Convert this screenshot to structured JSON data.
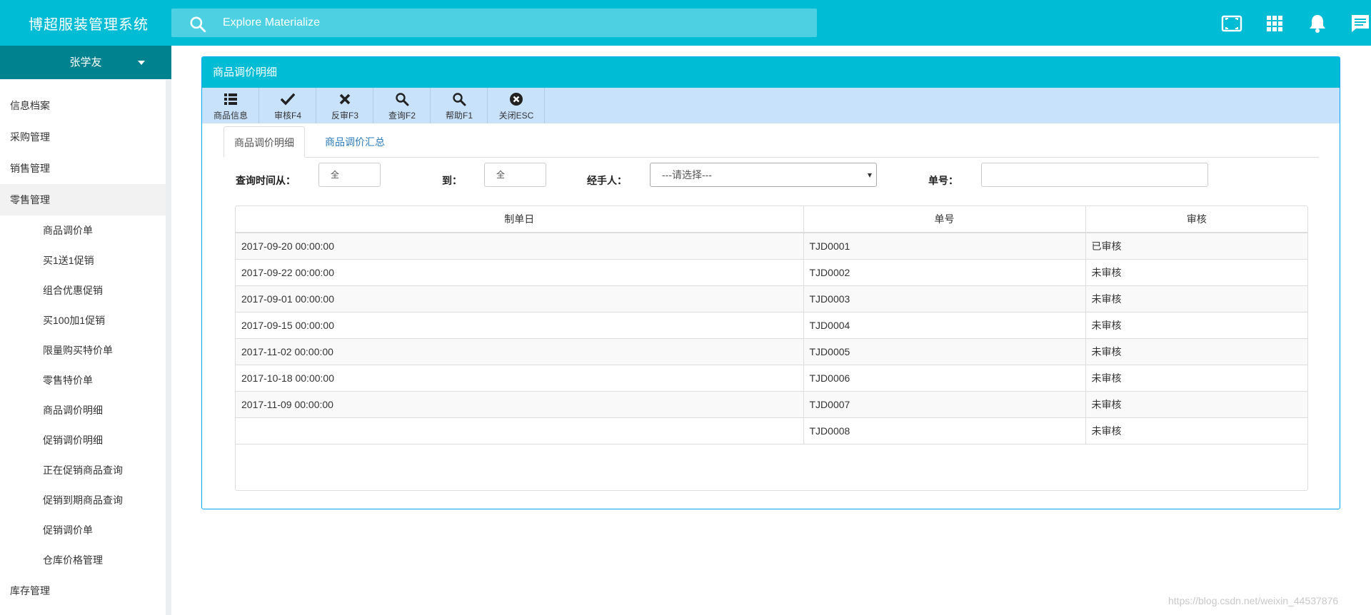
{
  "app": {
    "title": "博超服装管理系统"
  },
  "search": {
    "placeholder": "Explore Materialize"
  },
  "top_icons": [
    "fullscreen-icon",
    "apps-icon",
    "notifications-icon",
    "chat-icon"
  ],
  "user": {
    "name": "张学友"
  },
  "sidebar": {
    "items": [
      {
        "label": "信息档案"
      },
      {
        "label": "采购管理"
      },
      {
        "label": "销售管理"
      },
      {
        "label": "零售管理",
        "active": true,
        "children": [
          "商品调价单",
          "买1送1促销",
          "组合优惠促销",
          "买100加1促销",
          "限量购买特价单",
          "零售特价单",
          "商品调价明细",
          "促销调价明细",
          "正在促销商品查询",
          "促销到期商品查询",
          "促销调价单",
          "仓库价格管理"
        ]
      },
      {
        "label": "库存管理"
      }
    ]
  },
  "panel": {
    "title": "商品调价明细"
  },
  "toolbar": [
    {
      "label": "商品信息",
      "icon": "list-icon"
    },
    {
      "label": "审核F4",
      "icon": "check-icon"
    },
    {
      "label": "反审F3",
      "icon": "x-icon"
    },
    {
      "label": "查询F2",
      "icon": "search-icon"
    },
    {
      "label": "帮助F1",
      "icon": "search-icon"
    },
    {
      "label": "关闭ESC",
      "icon": "close-circle-icon"
    }
  ],
  "tabs": {
    "active": "商品调价明细",
    "other": "商品调价汇总"
  },
  "filters": {
    "from_label": "查询时间从：",
    "from_value": "全",
    "to_label": "到：",
    "to_value": "全",
    "handler_label": "经手人：",
    "handler_value": "---请选择---",
    "number_label": "单号：",
    "number_value": ""
  },
  "table": {
    "headers": [
      "制单日",
      "单号",
      "审核"
    ],
    "rows": [
      [
        "2017-09-20 00:00:00",
        "TJD0001",
        "已审核"
      ],
      [
        "2017-09-22 00:00:00",
        "TJD0002",
        "未审核"
      ],
      [
        "2017-09-01 00:00:00",
        "TJD0003",
        "未审核"
      ],
      [
        "2017-09-15 00:00:00",
        "TJD0004",
        "未审核"
      ],
      [
        "2017-11-02 00:00:00",
        "TJD0005",
        "未审核"
      ],
      [
        "2017-10-18 00:00:00",
        "TJD0006",
        "未审核"
      ],
      [
        "2017-11-09 00:00:00",
        "TJD0007",
        "未审核"
      ],
      [
        "",
        "TJD0008",
        "未审核"
      ]
    ]
  },
  "watermark": "https://blog.csdn.net/weixin_44537876",
  "colors": {
    "primary": "#00bcd4",
    "user_bar": "#00838f",
    "toolbar_bg": "#c9e2fb",
    "panel_border": "#03a9f4",
    "tab_link": "#2a7ab8"
  }
}
